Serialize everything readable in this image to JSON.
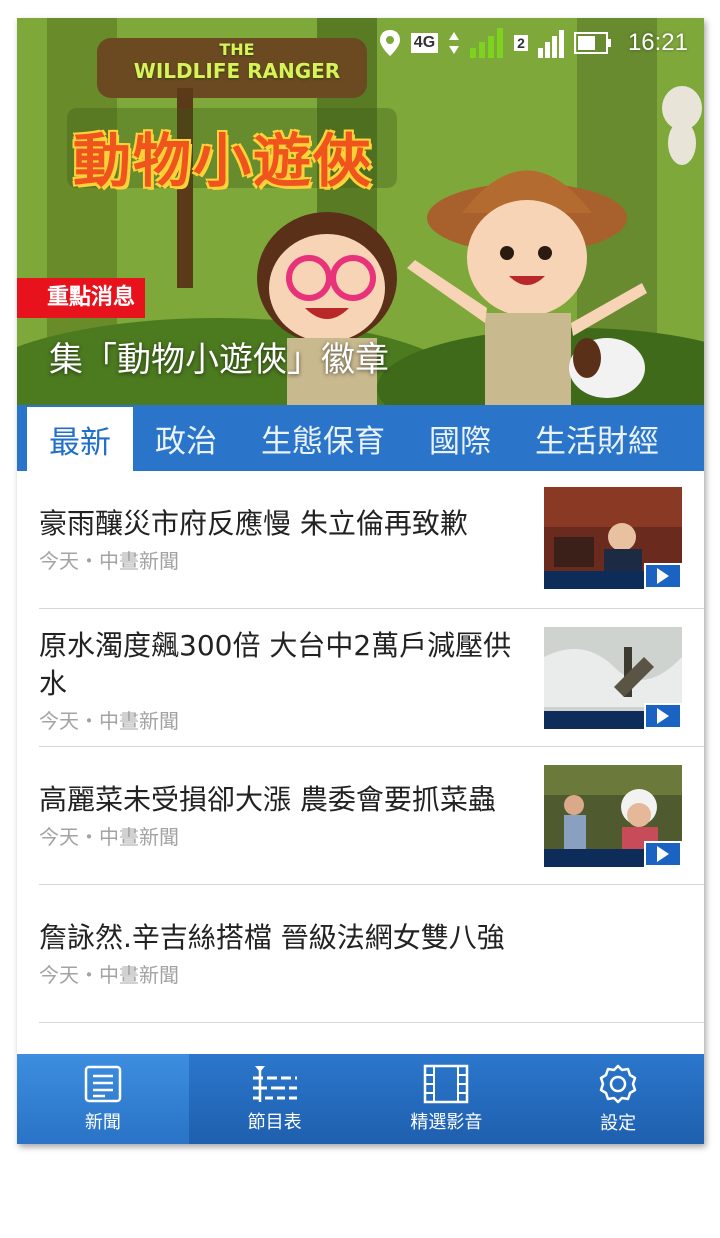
{
  "status_bar": {
    "network": "4G",
    "sim": "2",
    "time": "16:21"
  },
  "hero": {
    "logo_line1": "THE",
    "logo_line2": "WILDLIFE RANGER",
    "show_title": "動物小遊俠",
    "badge": "重點消息",
    "title": "集「動物小遊俠」徽章"
  },
  "tabs": [
    {
      "label": "最新",
      "active": true
    },
    {
      "label": "政治",
      "active": false
    },
    {
      "label": "生態保育",
      "active": false
    },
    {
      "label": "國際",
      "active": false
    },
    {
      "label": "生活財經",
      "active": false
    }
  ],
  "news": [
    {
      "title": "豪雨釀災市府反應慢 朱立倫再致歉",
      "meta": "今天・中晝新聞",
      "has_video": true
    },
    {
      "title": "原水濁度飆300倍 大台中2萬戶減壓供水",
      "meta": "今天・中晝新聞",
      "has_video": true
    },
    {
      "title": "高麗菜未受損卻大漲 農委會要抓菜蟲",
      "meta": "今天・中晝新聞",
      "has_video": true
    },
    {
      "title": "詹詠然.辛吉絲搭檔 晉級法網女雙八強",
      "meta": "今天・中晝新聞",
      "has_video": false
    }
  ],
  "bottom_nav": [
    {
      "label": "新聞",
      "icon": "news-icon",
      "active": true
    },
    {
      "label": "節目表",
      "icon": "schedule-icon",
      "active": false
    },
    {
      "label": "精選影音",
      "icon": "film-icon",
      "active": false
    },
    {
      "label": "設定",
      "icon": "gear-icon",
      "active": false
    }
  ],
  "colors": {
    "primary": "#2a75c9",
    "badge": "#e8121d",
    "play": "#1a63c2"
  }
}
